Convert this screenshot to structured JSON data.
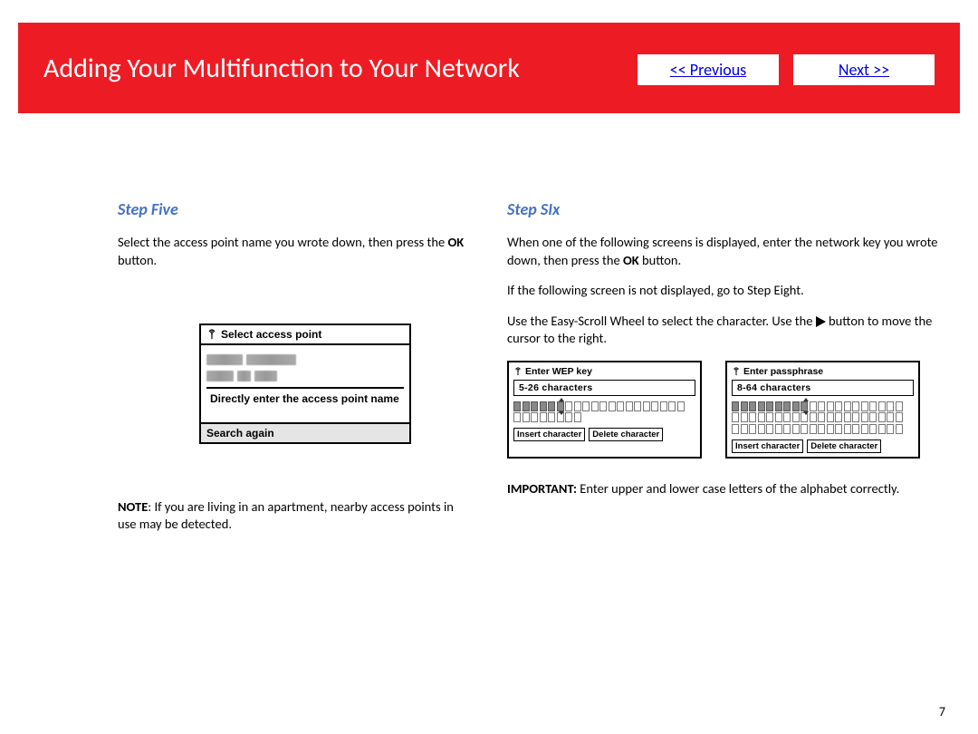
{
  "header": {
    "title": "Adding Your Multifunction to Your Network",
    "prev_label": "<< Previous",
    "next_label": "Next >>"
  },
  "step5": {
    "heading": "Step Five",
    "p1a": "Select the access point name you wrote down, then press the ",
    "p1b": "OK",
    "p1c": " button.",
    "lcd_title": "Select access point",
    "lcd_direct": "Directly enter the access point name",
    "lcd_search": "Search again",
    "note_label": "NOTE",
    "note_text": ":  If you are living in an apartment, nearby access points in use may be detected."
  },
  "step6": {
    "heading": "Step SIx",
    "p1a": "When one of the following screens is displayed, enter the network key you wrote down, then press the ",
    "p1b": "OK",
    "p1c": " button.",
    "p2": "If the following screen is not displayed, go to Step Eight.",
    "p3a": "Use the Easy-Scroll Wheel to select the character. Use the ",
    "p3b": " button to move the cursor to the right.",
    "wep": {
      "title": "Enter WEP key",
      "hint": "5-26 characters",
      "btn_insert": "Insert character",
      "btn_delete": "Delete character"
    },
    "pass": {
      "title": "Enter passphrase",
      "hint": "8-64 characters",
      "btn_insert": "Insert character",
      "btn_delete": "Delete character"
    },
    "important_label": "IMPORTANT:",
    "important_text": "  Enter upper and lower case letters of the alphabet correctly."
  },
  "page_number": "7"
}
